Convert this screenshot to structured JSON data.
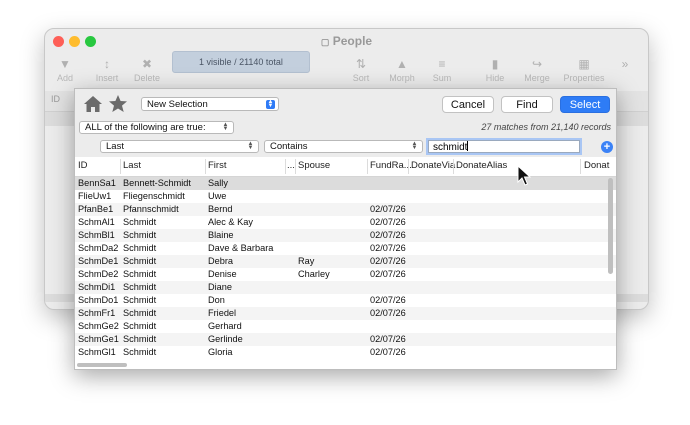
{
  "background_window": {
    "title": "People",
    "search_status": "1 visible / 21140 total",
    "tools": [
      "Add",
      "Insert",
      "Delete",
      "Sort",
      "Morph",
      "Sum",
      "Hide",
      "Merge",
      "Properties"
    ],
    "header_label": "ID"
  },
  "dialog": {
    "selection_popup": "New Selection",
    "buttons": {
      "cancel": "Cancel",
      "find": "Find",
      "select": "Select"
    },
    "condition": "ALL of the following are true:",
    "matches_text": "27 matches from 21,140 records",
    "criteria": {
      "field": "Last",
      "operator": "Contains",
      "value": "schmidt"
    }
  },
  "table": {
    "columns": [
      "ID",
      "Last",
      "First",
      "...",
      "Spouse",
      "FundRa...",
      "DonateVia",
      "DonateAlias",
      "Donat"
    ],
    "rows": [
      {
        "id": "BennSa1",
        "last": "Bennett-Schmidt",
        "first": "Sally",
        "spouse": "",
        "date": ""
      },
      {
        "id": "FlieUw1",
        "last": "Fliegenschmidt",
        "first": "Uwe",
        "spouse": "",
        "date": ""
      },
      {
        "id": "PfanBe1",
        "last": "Pfannschmidt",
        "first": "Bernd",
        "spouse": "",
        "date": "02/07/26"
      },
      {
        "id": "SchmAl1",
        "last": "Schmidt",
        "first": "Alec & Kay",
        "spouse": "",
        "date": "02/07/26"
      },
      {
        "id": "SchmBl1",
        "last": "Schmidt",
        "first": "Blaine",
        "spouse": "",
        "date": "02/07/26"
      },
      {
        "id": "SchmDa2",
        "last": "Schmidt",
        "first": "Dave & Barbara",
        "spouse": "",
        "date": "02/07/26"
      },
      {
        "id": "SchmDe1",
        "last": "Schmidt",
        "first": "Debra",
        "spouse": "Ray",
        "date": "02/07/26"
      },
      {
        "id": "SchmDe2",
        "last": "Schmidt",
        "first": "Denise",
        "spouse": "Charley",
        "date": "02/07/26"
      },
      {
        "id": "SchmDi1",
        "last": "Schmidt",
        "first": "Diane",
        "spouse": "",
        "date": ""
      },
      {
        "id": "SchmDo1",
        "last": "Schmidt",
        "first": "Don",
        "spouse": "",
        "date": "02/07/26"
      },
      {
        "id": "SchmFr1",
        "last": "Schmidt",
        "first": "Friedel",
        "spouse": "",
        "date": "02/07/26"
      },
      {
        "id": "SchmGe2",
        "last": "Schmidt",
        "first": "Gerhard",
        "spouse": "",
        "date": ""
      },
      {
        "id": "SchmGe1",
        "last": "Schmidt",
        "first": "Gerlinde",
        "spouse": "",
        "date": "02/07/26"
      },
      {
        "id": "SchmGl1",
        "last": "Schmidt",
        "first": "Gloria",
        "spouse": "",
        "date": "02/07/26"
      }
    ]
  },
  "colors": {
    "accent": "#2e7cf6",
    "selected_row": "#dcdcdc",
    "focus_ring": "#a9c6f4"
  },
  "icons": [
    "home-icon",
    "star-icon",
    "add-criterion-icon",
    "mouse-pointer-icon"
  ]
}
